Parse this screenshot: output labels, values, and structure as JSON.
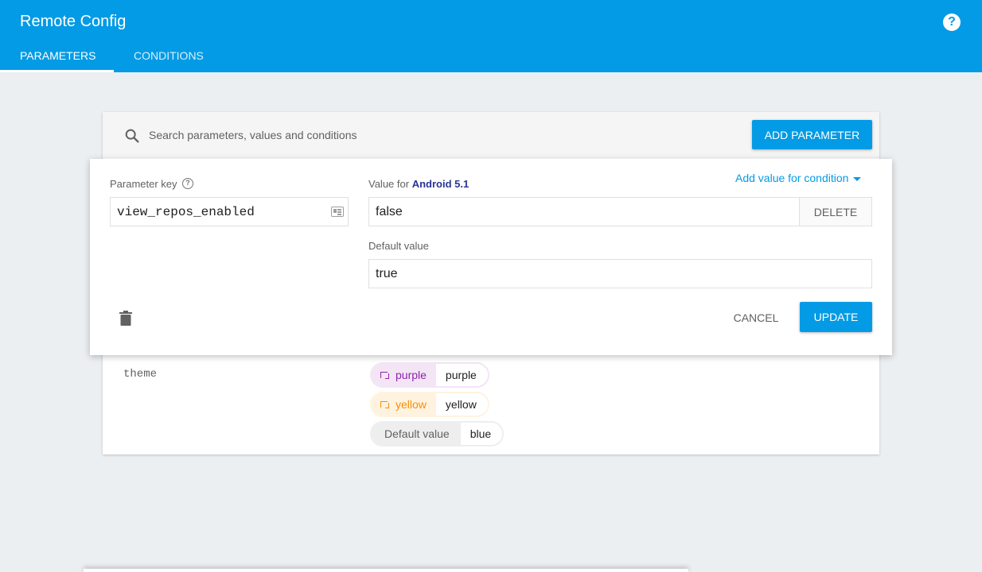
{
  "header": {
    "title": "Remote Config",
    "help_icon": "?",
    "tabs": [
      {
        "label": "PARAMETERS",
        "active": true
      },
      {
        "label": "CONDITIONS",
        "active": false
      }
    ]
  },
  "search": {
    "placeholder": "Search parameters, values and conditions",
    "value": "",
    "add_button": "ADD PARAMETER"
  },
  "editor": {
    "key_label": "Parameter key",
    "key_value": "view_repos_enabled",
    "value_for_label": "Value for",
    "condition_name": "Android 5.1",
    "add_condition_label": "Add value for condition",
    "condition_value": "false",
    "delete_label": "DELETE",
    "default_label": "Default value",
    "default_value": "true",
    "cancel_label": "CANCEL",
    "update_label": "UPDATE"
  },
  "parameter": {
    "key": "theme",
    "values": [
      {
        "condition": "purple",
        "value": "purple",
        "color": "#8e24aa"
      },
      {
        "condition": "yellow",
        "value": "yellow",
        "color": "#fb8c00"
      },
      {
        "condition": "Default value",
        "value": "blue"
      }
    ]
  },
  "colors": {
    "primary": "#039be5",
    "condition_accent": "#283593",
    "background": "#eceff1"
  }
}
